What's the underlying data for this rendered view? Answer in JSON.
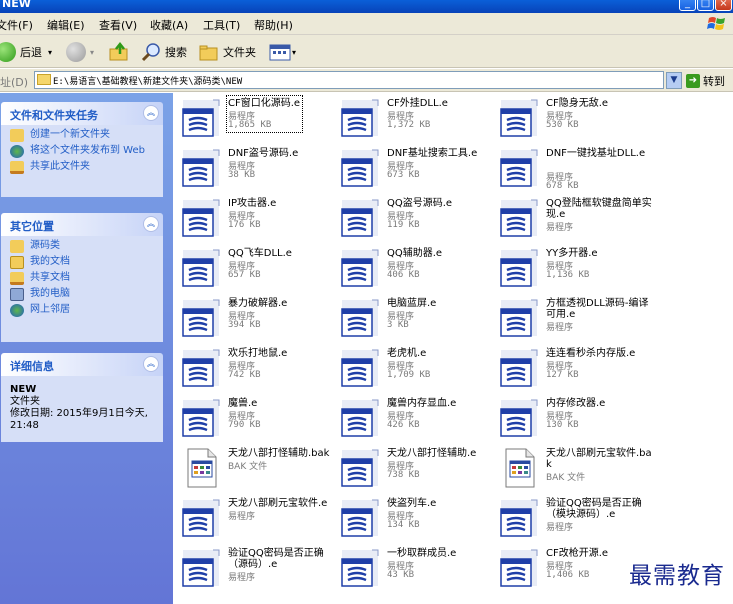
{
  "window": {
    "title": "NEW"
  },
  "menu": [
    "文件(F)",
    "编辑(E)",
    "查看(V)",
    "收藏(A)",
    "工具(T)",
    "帮助(H)"
  ],
  "toolbar": {
    "back": "后退",
    "search": "搜索",
    "folders": "文件夹"
  },
  "address": {
    "label": "址(D)",
    "path": "E:\\易语言\\基础教程\\新建文件夹\\源码类\\NEW",
    "go": "转到"
  },
  "file_tasks": {
    "title": "文件和文件夹任务",
    "items": [
      "创建一个新文件夹",
      "将这个文件夹发布到 Web",
      "共享此文件夹"
    ]
  },
  "other_places": {
    "title": "其它位置",
    "items": [
      "源码类",
      "我的文档",
      "共享文档",
      "我的电脑",
      "网上邻居"
    ]
  },
  "details": {
    "title": "详细信息",
    "name": "NEW",
    "type": "文件夹",
    "modified": "修改日期: 2015年9月1日今天, 21:48"
  },
  "files": [
    {
      "name": "CF窗口化源码.e",
      "type": "易程序",
      "size": "1,865 KB",
      "icon": "e-program-icon"
    },
    {
      "name": "CF外挂DLL.e",
      "type": "易程序",
      "size": "1,372 KB",
      "icon": "e-program-icon"
    },
    {
      "name": "CF隐身无敌.e",
      "type": "易程序",
      "size": "530 KB",
      "icon": "e-program-icon"
    },
    {
      "name": "DNF盗号源码.e",
      "type": "易程序",
      "size": "38 KB",
      "icon": "e-program-icon"
    },
    {
      "name": "DNF基址搜索工具.e",
      "type": "易程序",
      "size": "673 KB",
      "icon": "e-program-icon"
    },
    {
      "name": "DNF一键找基址DLL.e",
      "type": "易程序",
      "size": "678 KB",
      "icon": "e-program-icon"
    },
    {
      "name": "IP攻击器.e",
      "type": "易程序",
      "size": "176 KB",
      "icon": "e-program-icon"
    },
    {
      "name": "QQ盗号源码.e",
      "type": "易程序",
      "size": "119 KB",
      "icon": "e-program-icon"
    },
    {
      "name": "QQ登陆框软键盘简单实现.e",
      "type": "易程序",
      "size": "",
      "icon": "e-program-icon"
    },
    {
      "name": "QQ飞车DLL.e",
      "type": "易程序",
      "size": "657 KB",
      "icon": "e-program-icon"
    },
    {
      "name": "QQ辅助器.e",
      "type": "易程序",
      "size": "406 KB",
      "icon": "e-program-icon"
    },
    {
      "name": "YY多开器.e",
      "type": "易程序",
      "size": "1,136 KB",
      "icon": "e-program-icon"
    },
    {
      "name": "暴力破解器.e",
      "type": "易程序",
      "size": "394 KB",
      "icon": "e-program-icon"
    },
    {
      "name": "电脑蓝屏.e",
      "type": "易程序",
      "size": "3 KB",
      "icon": "e-program-icon"
    },
    {
      "name": "方框透视DLL源码-编译可用.e",
      "type": "易程序",
      "size": "",
      "icon": "e-program-icon"
    },
    {
      "name": "欢乐打地鼠.e",
      "type": "易程序",
      "size": "742 KB",
      "icon": "e-program-icon"
    },
    {
      "name": "老虎机.e",
      "type": "易程序",
      "size": "1,709 KB",
      "icon": "e-program-icon"
    },
    {
      "name": "连连看秒杀内存版.e",
      "type": "易程序",
      "size": "127 KB",
      "icon": "e-program-icon"
    },
    {
      "name": "魔兽.e",
      "type": "易程序",
      "size": "790 KB",
      "icon": "e-program-icon"
    },
    {
      "name": "魔兽内存显血.e",
      "type": "易程序",
      "size": "426 KB",
      "icon": "e-program-icon"
    },
    {
      "name": "内存修改器.e",
      "type": "易程序",
      "size": "130 KB",
      "icon": "e-program-icon"
    },
    {
      "name": "天龙八部打怪辅助.bak",
      "type": "BAK 文件",
      "size": "",
      "icon": "bak-file-icon"
    },
    {
      "name": "天龙八部打怪辅助.e",
      "type": "易程序",
      "size": "738 KB",
      "icon": "e-program-icon"
    },
    {
      "name": "天龙八部刷元宝软件.bak",
      "type": "BAK 文件",
      "size": "",
      "icon": "bak-file-icon"
    },
    {
      "name": "天龙八部刷元宝软件.e",
      "type": "易程序",
      "size": "",
      "icon": "e-program-icon"
    },
    {
      "name": "侠盗列车.e",
      "type": "易程序",
      "size": "134 KB",
      "icon": "e-program-icon"
    },
    {
      "name": "验证QQ密码是否正确（模块源码）.e",
      "type": "易程序",
      "size": "",
      "icon": "e-program-icon"
    },
    {
      "name": "验证QQ密码是否正确（源码）.e",
      "type": "易程序",
      "size": "",
      "icon": "e-program-icon"
    },
    {
      "name": "一秒取群成员.e",
      "type": "易程序",
      "size": "43 KB",
      "icon": "e-program-icon"
    },
    {
      "name": "CF改枪开源.e",
      "type": "易程序",
      "size": "1,406 KB",
      "icon": "e-program-icon"
    }
  ],
  "watermark": "最需教育"
}
